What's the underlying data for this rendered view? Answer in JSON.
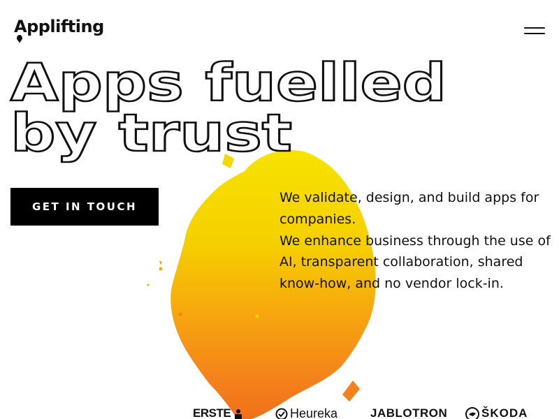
{
  "brand": {
    "name": "Applifting"
  },
  "header": {
    "menu_icon": "hamburger-icon"
  },
  "hero": {
    "line1": "Apps fuelled",
    "line2": "by trust"
  },
  "cta": {
    "label": "GET IN TOUCH"
  },
  "description": {
    "para1": "We validate, design, and build apps for companies.",
    "para2": "We enhance business through the use of AI, transparent collaboration, shared know-how, and no vendor lock-in."
  },
  "clients": [
    "ERSTE",
    "Heureka",
    "JABLOTRON",
    "ŠKODA"
  ],
  "colors": {
    "accent_yellow": "#f5d800",
    "accent_orange": "#f47a1f",
    "text": "#111111",
    "button_bg": "#000000"
  }
}
